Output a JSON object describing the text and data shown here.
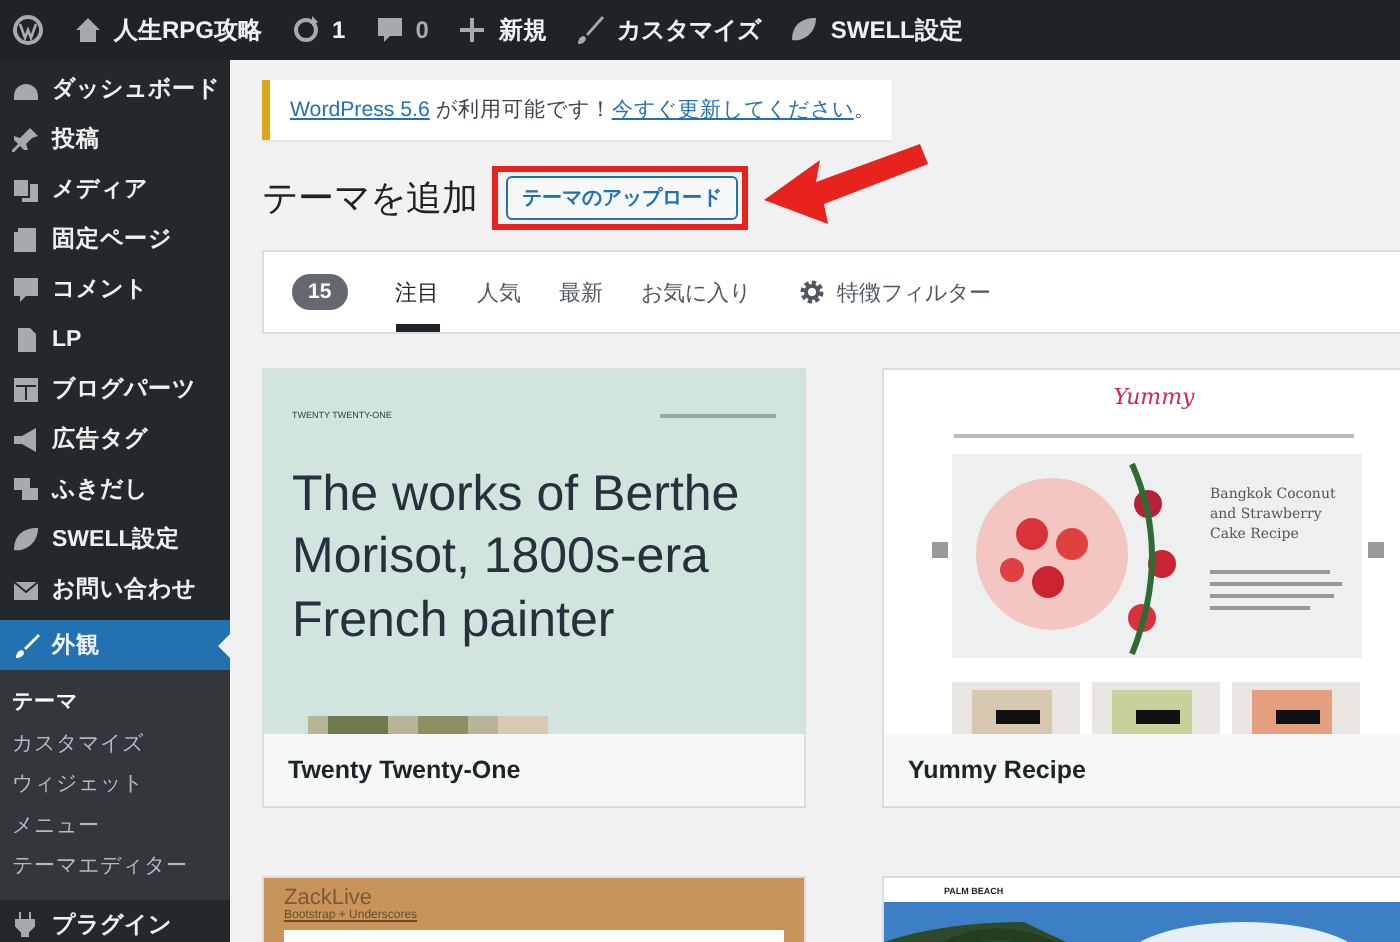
{
  "admin_bar": {
    "items": [
      {
        "kind": "logo"
      },
      {
        "kind": "site",
        "label": "人生RPG攻略"
      },
      {
        "kind": "updates",
        "label": "1"
      },
      {
        "kind": "comments",
        "label": "0"
      },
      {
        "kind": "new",
        "label": "新規"
      },
      {
        "kind": "customize",
        "label": "カスタマイズ"
      },
      {
        "kind": "swell",
        "label": "SWELL設定"
      }
    ]
  },
  "sidebar": {
    "items": [
      {
        "label": "ダッシュボード",
        "selected": false
      },
      {
        "label": "投稿",
        "selected": false
      },
      {
        "label": "メディア",
        "selected": false
      },
      {
        "label": "固定ページ",
        "selected": false
      },
      {
        "label": "コメント",
        "selected": false
      },
      {
        "label": "LP",
        "selected": false
      },
      {
        "label": "ブログパーツ",
        "selected": false
      },
      {
        "label": "広告タグ",
        "selected": false
      },
      {
        "label": "ふきだし",
        "selected": false
      },
      {
        "label": "SWELL設定",
        "selected": false
      },
      {
        "label": "お問い合わせ",
        "selected": false
      },
      {
        "label": "外観",
        "selected": true,
        "children": [
          {
            "label": "テーマ",
            "selected": true
          },
          {
            "label": "カスタマイズ",
            "selected": false
          },
          {
            "label": "ウィジェット",
            "selected": false
          },
          {
            "label": "メニュー",
            "selected": false
          },
          {
            "label": "テーマエディター",
            "selected": false
          }
        ]
      },
      {
        "label": "プラグイン",
        "selected": false
      }
    ]
  },
  "notice": {
    "parts": [
      {
        "kind": "link",
        "text": "WordPress 5.6"
      },
      {
        "kind": "text",
        "text": " が利用可能です！"
      },
      {
        "kind": "link",
        "text": "今すぐ更新してください"
      },
      {
        "kind": "text",
        "text": "。"
      }
    ]
  },
  "page_title": "テーマを追加",
  "upload_button": "テーマのアップロード",
  "filter_bar": {
    "count": "15",
    "tabs": [
      {
        "label": "注目",
        "selected": true
      },
      {
        "label": "人気",
        "selected": false
      },
      {
        "label": "最新",
        "selected": false
      },
      {
        "label": "お気に入り",
        "selected": false
      }
    ],
    "feature_filter": "特徴フィルター"
  },
  "themes": [
    {
      "name": "Twenty Twenty-One",
      "preview": {
        "kind": "twentyone",
        "site_title": "TWENTY TWENTY-ONE",
        "headline": "The works of Berthe Morisot, 1800s-era French painter"
      }
    },
    {
      "name": "Yummy Recipe",
      "preview": {
        "kind": "yummy",
        "logo": "Yummy",
        "headline": "Bangkok Coconut and Strawberry Cake Recipe"
      }
    },
    {
      "preview": {
        "kind": "zacklive",
        "site_title": "ZackLive",
        "tagline": "Bootstrap + Underscores"
      }
    },
    {
      "preview": {
        "kind": "palmbeach",
        "site_title": "PALM BEACH"
      }
    }
  ]
}
